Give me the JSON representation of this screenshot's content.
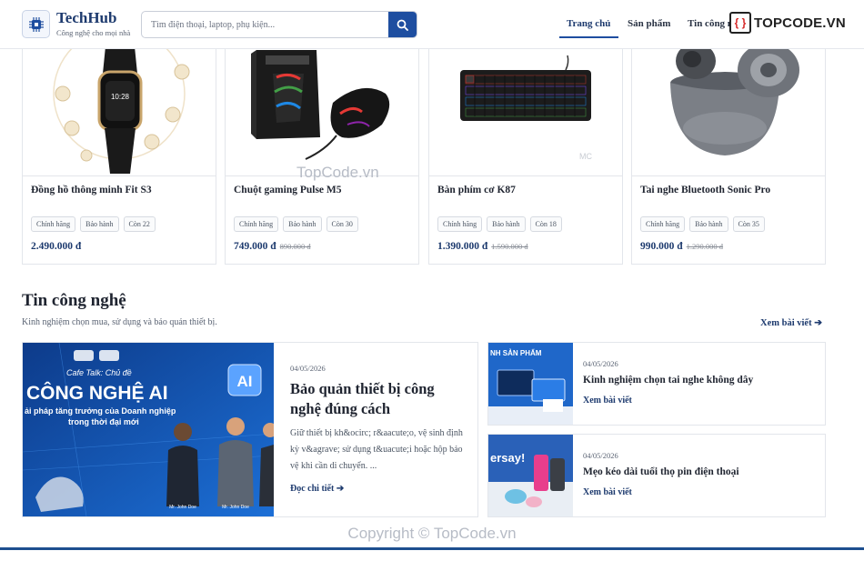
{
  "header": {
    "brand": "TechHub",
    "tagline": "Công nghệ cho mọi nhà",
    "search_placeholder": "Tìm điện thoại, laptop, phụ kiện...",
    "nav": {
      "home": "Trang chủ",
      "products": "Sản phẩm",
      "news": "Tin công ng"
    }
  },
  "watermark": {
    "logo_text": "TOPCODE.VN",
    "mid": "TopCode.vn",
    "copyright": "Copyright © TopCode.vn"
  },
  "products": [
    {
      "name": "Đồng hồ thông minh Fit S3",
      "tags": [
        "Chính hãng",
        "Bảo hành",
        "Còn 22"
      ],
      "price": "2.490.000 đ",
      "old_price": ""
    },
    {
      "name": "Chuột gaming Pulse M5",
      "tags": [
        "Chính hãng",
        "Bảo hành",
        "Còn 30"
      ],
      "price": "749.000 đ",
      "old_price": "890.000 đ"
    },
    {
      "name": "Bàn phím cơ K87",
      "tags": [
        "Chính hãng",
        "Bảo hành",
        "Còn 18"
      ],
      "price": "1.390.000 đ",
      "old_price": "1.590.000 đ"
    },
    {
      "name": "Tai nghe Bluetooth Sonic Pro",
      "tags": [
        "Chính hãng",
        "Bảo hành",
        "Còn 35"
      ],
      "price": "990.000 đ",
      "old_price": "1.290.000 đ"
    }
  ],
  "news": {
    "title": "Tin công nghệ",
    "subtitle": "Kinh nghiệm chọn mua, sử dụng và bảo quản thiết bị.",
    "more": "Xem bài viết",
    "featured": {
      "date": "04/05/2026",
      "title": "Bảo quản thiết bị công nghệ đúng cách",
      "excerpt": "Giữ thiết bị kh&ocirc; r&aacute;o, vệ sinh định kỳ v&agrave; sử dụng t&uacute;i hoặc hộp bảo vệ khi cần di chuyển. ...",
      "read": "Đọc chi tiết",
      "image_text": {
        "badge": "AI",
        "cafe": "Cafe Talk: Chủ đề",
        "headline": "CÔNG NGHỆ AI",
        "sub1": "ải pháp tăng trưởng của Doanh nghiệp",
        "sub2": "trong thời đại mới",
        "speaker": "Mr. John Doe"
      }
    },
    "side": [
      {
        "date": "04/05/2026",
        "title": "Kinh nghiệm chọn tai nghe không dây",
        "read": "Xem bài viết",
        "image_text": "NH SẢN PHẨM"
      },
      {
        "date": "04/05/2026",
        "title": "Mẹo kéo dài tuổi thọ pin điện thoại",
        "read": "Xem bài viết",
        "image_text": "ersay!"
      }
    ]
  },
  "colors": {
    "primary": "#1d3a6e",
    "accent": "#1e4ea0",
    "watermark_red": "#d62828"
  }
}
